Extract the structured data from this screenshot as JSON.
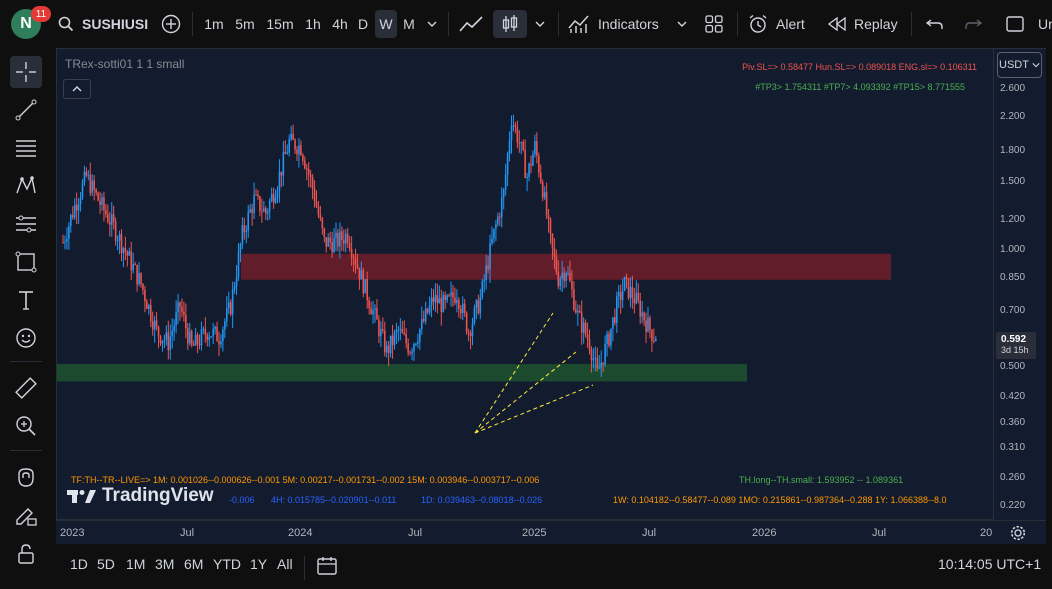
{
  "header": {
    "avatar_letter": "N",
    "notification_count": "11",
    "symbol": "SUSHIUSI",
    "timeframes": [
      "1m",
      "5m",
      "15m",
      "1h",
      "4h",
      "D",
      "W",
      "M"
    ],
    "active_timeframe": "W",
    "indicators_label": "Indicators",
    "alert_label": "Alert",
    "replay_label": "Replay",
    "cut_label": "Ur"
  },
  "chart": {
    "legend": "TRex-sotti01 1 1 small",
    "currency": "USDT",
    "sl_line": "Piv.SL=> 0.58477  Hun.SL=> 0.089018  ENG.sl=> 0.106311",
    "tp_line": "#TP3> 1.754311  #TP7> 4.093392  #TP15> 8.771555",
    "live_line": "TF:TH--TR--LIVE=>   1M: 0.001026--0.000626--0.001     5M: 0.00217--0.001731--0.002     15M: 0.003946--0.003717--0.006",
    "line2_1h": "-0.006",
    "line2_4h": "4H: 0.015785--0.020901--0.011",
    "line2_1d": "1D: 0.039463--0.08018--0.026",
    "th_line": "TH.long--TH.small: 1.593952 -- 1.089361",
    "weekly_line": "1W: 0.104182--0.58477--0.089    1MO: 0.215861--0.987364--0.288    1Y: 1.066388--8.0",
    "watermark": "TradingView",
    "current_price": "0.592",
    "countdown": "3d 15h",
    "colors": {
      "up": "#2196f3",
      "down": "#ef5350",
      "resistance": "#6b1e2a",
      "support": "#1b4d2e"
    }
  },
  "chart_data": {
    "type": "candlestick",
    "y_scale": "log",
    "price_ticks": [
      "2.600",
      "2.200",
      "1.800",
      "1.500",
      "1.200",
      "1.000",
      "0.850",
      "0.700",
      "0.500",
      "0.420",
      "0.360",
      "0.310",
      "0.260",
      "0.220"
    ],
    "time_ticks": [
      "2023",
      "Jul",
      "2024",
      "Jul",
      "2025",
      "Jul",
      "2026",
      "Jul",
      "20"
    ],
    "last_price": 0.592,
    "resistance_zone": [
      0.84,
      0.98
    ],
    "support_zone": [
      0.46,
      0.51
    ]
  },
  "bottom": {
    "ranges": [
      "1D",
      "5D",
      "1M",
      "3M",
      "6M",
      "YTD",
      "1Y",
      "All"
    ],
    "clock": "10:14:05 UTC+1"
  },
  "icons": [
    "search-icon",
    "plus-circle-icon",
    "line-chart-icon",
    "candles-icon",
    "indicators-icon",
    "layout-icon",
    "alert-icon",
    "replay-icon",
    "undo-icon",
    "redo-icon",
    "crosshair-icon",
    "trendline-icon",
    "fib-icon",
    "pattern-icon",
    "forecast-icon",
    "shapes-icon",
    "text-icon",
    "emoji-icon",
    "ruler-icon",
    "zoom-icon",
    "magnet-icon",
    "lock-draw-icon",
    "lock-icon",
    "settings-icon",
    "calendar-icon"
  ]
}
